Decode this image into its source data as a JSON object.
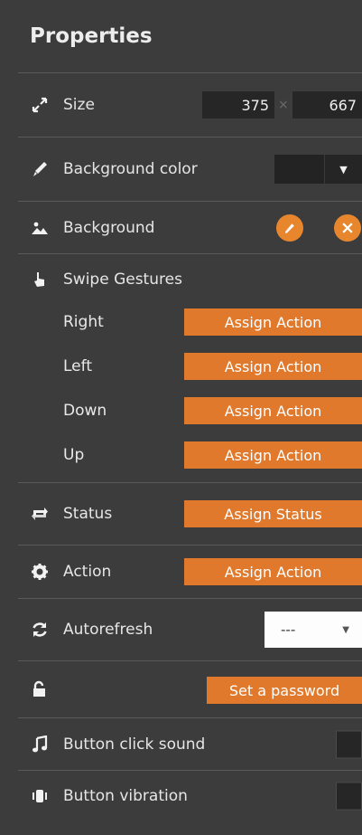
{
  "panel": {
    "title": "Properties"
  },
  "size": {
    "label": "Size",
    "width": "375",
    "times": "×",
    "height": "667"
  },
  "background_color": {
    "label": "Background color",
    "value_color": "#232323",
    "caret": "▼"
  },
  "background": {
    "label": "Background",
    "edit_icon": "pencil-icon",
    "remove_icon": "close-icon"
  },
  "swipe": {
    "label": "Swipe Gestures",
    "items": [
      {
        "direction": "Right",
        "button": "Assign Action"
      },
      {
        "direction": "Left",
        "button": "Assign Action"
      },
      {
        "direction": "Down",
        "button": "Assign Action"
      },
      {
        "direction": "Up",
        "button": "Assign Action"
      }
    ]
  },
  "status": {
    "label": "Status",
    "button": "Assign Status"
  },
  "action": {
    "label": "Action",
    "button": "Assign Action"
  },
  "autorefresh": {
    "label": "Autorefresh",
    "value": "---",
    "caret": "▼"
  },
  "password": {
    "button": "Set a password"
  },
  "button_click_sound": {
    "label": "Button click sound",
    "checked": false
  },
  "button_vibration": {
    "label": "Button vibration",
    "checked": false
  },
  "colors": {
    "accent": "#e0792b",
    "panel_bg": "#3c3c3c",
    "field_bg": "#262626"
  }
}
